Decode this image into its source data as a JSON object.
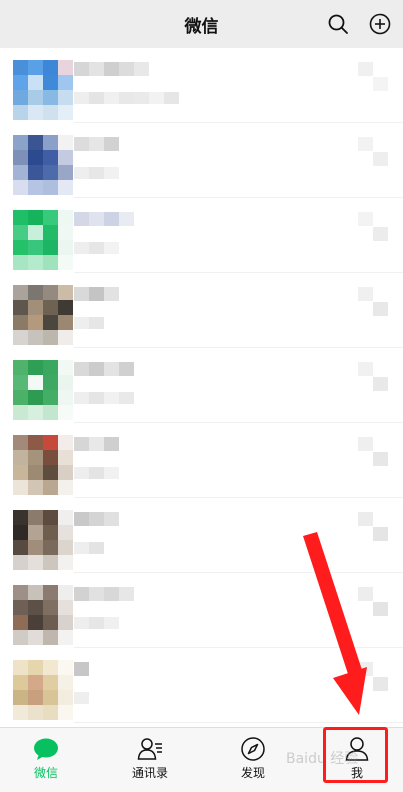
{
  "header": {
    "title": "微信",
    "search_icon": "search-icon",
    "add_icon": "plus-circle-icon"
  },
  "chats": [
    {
      "avatar": [
        "#4a8fd9",
        "#5aa0e6",
        "#3d86d8",
        "#e8d4dc",
        "#5fa4e8",
        "#c9e0f5",
        "#3f8ad8",
        "#9fc6ee",
        "#6fa9df",
        "#a8cbe8",
        "#87b9e4",
        "#c6dcef",
        "#b9d3ea",
        "#d9e8f4",
        "#cfe0ef",
        "#e4eef6"
      ],
      "name_blocks": [
        "#d6d6d6",
        "#e3e3e3",
        "#cfcfcf",
        "#dcdcdc",
        "#e8e8e8"
      ],
      "msg_blocks": [
        "#eeeeee",
        "#e4e4e4",
        "#f0f0f0",
        "#e8e8e8",
        "#eaeaea",
        "#f2f2f2",
        "#e6e6e6"
      ],
      "time_blocks": [
        "#f0f0f0",
        "#f4f4f4"
      ]
    },
    {
      "avatar": [
        "#8ca3c9",
        "#3a5591",
        "#8aa0c8",
        "#f2f2f2",
        "#7e8fb8",
        "#2c4a8f",
        "#3f5ea3",
        "#c4cbe0",
        "#a3b3d6",
        "#3b5699",
        "#4d6aab",
        "#9aa6c6",
        "#d8def0",
        "#b6c4e3",
        "#aebedf",
        "#e3e8f4"
      ],
      "name_blocks": [
        "#dcdcdc",
        "#e6e6e6",
        "#d2d2d2"
      ],
      "msg_blocks": [
        "#eeeeee",
        "#e7e7e7",
        "#f1f1f1"
      ],
      "time_blocks": [
        "#f2f2f2",
        "#eeeeee"
      ]
    },
    {
      "avatar": [
        "#1fbf6a",
        "#15b35c",
        "#37c97c",
        "#eef8f2",
        "#47cc86",
        "#c8efd9",
        "#22bb68",
        "#f0f8f3",
        "#25c06a",
        "#38c67c",
        "#1bb565",
        "#eaf6ef",
        "#a6e6c3",
        "#b4ebcc",
        "#9fe3bd",
        "#f4faf6"
      ],
      "name_blocks": [
        "#d4d8e6",
        "#e0e3ee",
        "#cdd2e4",
        "#e9ebf3"
      ],
      "msg_blocks": [
        "#eeeeee",
        "#e6e6e6",
        "#f2f2f2"
      ],
      "time_blocks": [
        "#f3f3f3",
        "#ececec"
      ]
    },
    {
      "avatar": [
        "#a9a39c",
        "#7b766f",
        "#948a80",
        "#ccbba7",
        "#5f574e",
        "#a28f7a",
        "#6e6253",
        "#3f3a33",
        "#8a7a66",
        "#b39a7d",
        "#4b463e",
        "#9c8772",
        "#d7d3cf",
        "#c7c2bc",
        "#bdb6ad",
        "#efece9"
      ],
      "name_blocks": [
        "#d9d9d9",
        "#c4c4c4",
        "#e2e2e2"
      ],
      "msg_blocks": [
        "#eeeeee",
        "#e6e6e6"
      ],
      "time_blocks": [
        "#f0f0f0",
        "#e8e8e8"
      ]
    },
    {
      "avatar": [
        "#4fb36c",
        "#2f9f55",
        "#3aa85f",
        "#f2f8f4",
        "#58b876",
        "#f3faf5",
        "#3fa862",
        "#e9f5ed",
        "#4bb068",
        "#2d9b52",
        "#44ad66",
        "#eef7f1",
        "#c9e9d3",
        "#d6efde",
        "#c3e6ce",
        "#f7fbf8"
      ],
      "name_blocks": [
        "#d9d9d9",
        "#cccccc",
        "#e3e3e3",
        "#d0d0d0"
      ],
      "msg_blocks": [
        "#eeeeee",
        "#e5e5e5",
        "#f1f1f1",
        "#e9e9e9"
      ],
      "time_blocks": [
        "#f1f1f1",
        "#e9e9e9"
      ]
    },
    {
      "avatar": [
        "#a3897a",
        "#8c5a46",
        "#c54a3b",
        "#f2ecea",
        "#c2b39f",
        "#a6937b",
        "#7a4e3d",
        "#e8dfd6",
        "#c8b59a",
        "#9d8a73",
        "#5e4c3e",
        "#d9cfc4",
        "#ece3d9",
        "#d3c5b4",
        "#b9a791",
        "#f4f0ec"
      ],
      "name_blocks": [
        "#d6d6d6",
        "#e8e8e8",
        "#cfcfcf"
      ],
      "msg_blocks": [
        "#eeeeee",
        "#e4e4e4",
        "#f1f1f1"
      ],
      "time_blocks": [
        "#efefef",
        "#e7e7e7"
      ]
    },
    {
      "avatar": [
        "#3a322c",
        "#8b7b6d",
        "#5d4b3f",
        "#f1efed",
        "#2f2a26",
        "#b3a392",
        "#6f5d4e",
        "#e6e1dc",
        "#574a40",
        "#a08d7a",
        "#7a6a5c",
        "#dcd5ce",
        "#d6d1cc",
        "#e4dfda",
        "#cdc6bf",
        "#f3f1ef"
      ],
      "name_blocks": [
        "#c9c9c9",
        "#d4d4d4",
        "#e0e0e0"
      ],
      "msg_blocks": [
        "#eeeeee",
        "#e3e3e3"
      ],
      "time_blocks": [
        "#ececec",
        "#e5e5e5"
      ]
    },
    {
      "avatar": [
        "#9e9087",
        "#c8c1ba",
        "#8a7a70",
        "#f0eeec",
        "#6f6055",
        "#5d5047",
        "#7f6f62",
        "#e5e0dc",
        "#8f6c55",
        "#4b4039",
        "#6d5d50",
        "#d9d2cc",
        "#d1cbc6",
        "#e1dcd8",
        "#bfb6ae",
        "#f4f2f0"
      ],
      "name_blocks": [
        "#d2d2d2",
        "#e1e1e1",
        "#d8d8d8",
        "#e7e7e7"
      ],
      "msg_blocks": [
        "#eeeeee",
        "#e6e6e6",
        "#f0f0f0"
      ],
      "time_blocks": [
        "#ededed",
        "#e4e4e4"
      ]
    },
    {
      "avatar": [
        "#efe3c7",
        "#e6d6ad",
        "#f2e8d2",
        "#fbf8f2",
        "#ddc99a",
        "#d3a98a",
        "#e0cda2",
        "#f6f1e6",
        "#cbb587",
        "#c9a07e",
        "#d9c497",
        "#f3ede0",
        "#f1ead9",
        "#ece2cb",
        "#e8dcc1",
        "#faf7f1"
      ],
      "name_blocks": [
        "#c7c7c7"
      ],
      "msg_blocks": [
        "#eeeeee"
      ],
      "time_blocks": [
        "#eeeeee",
        "#e8e8e8"
      ]
    }
  ],
  "tabs": [
    {
      "label": "微信",
      "icon": "chat-bubble-icon"
    },
    {
      "label": "通讯录",
      "icon": "contacts-icon"
    },
    {
      "label": "发现",
      "icon": "compass-icon"
    },
    {
      "label": "我",
      "icon": "person-icon"
    }
  ],
  "colors": {
    "accent": "#07c160",
    "annotation": "#ff1c1c",
    "header_bg": "#ededed",
    "tabbar_bg": "#f7f7f7"
  },
  "watermark": "Baidu 经验"
}
